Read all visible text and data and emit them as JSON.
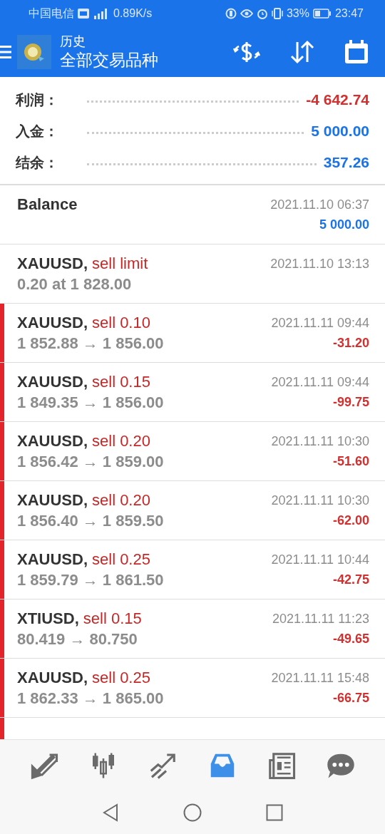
{
  "status_bar": {
    "carrier": "中国电信",
    "speed": "0.89K/s",
    "battery": "33%",
    "time": "23:47"
  },
  "header": {
    "title": "历史",
    "subtitle": "全部交易品种"
  },
  "summary": [
    {
      "label": "利润：",
      "value": "-4 642.74",
      "negative": true
    },
    {
      "label": "入金：",
      "value": "5 000.00",
      "negative": false
    },
    {
      "label": "结余：",
      "value": "357.26",
      "negative": false
    }
  ],
  "rows": [
    {
      "kind": "balance",
      "symbol": "Balance",
      "time": "2021.11.10 06:37",
      "profit": "5 000.00",
      "negative": false
    },
    {
      "kind": "order",
      "symbol": "XAUUSD,",
      "action": "sell limit",
      "color": "#c62828",
      "detail": "0.20 at 1 828.00",
      "time": "2021.11.10 13:13"
    },
    {
      "kind": "deal",
      "symbol": "XAUUSD,",
      "action": "sell 0.10",
      "color": "#c62828",
      "detail": "1 852.88 → 1 856.00",
      "time": "2021.11.11 09:44",
      "profit": "-31.20",
      "negative": true
    },
    {
      "kind": "deal",
      "symbol": "XAUUSD,",
      "action": "sell 0.15",
      "color": "#c62828",
      "detail": "1 849.35 → 1 856.00",
      "time": "2021.11.11 09:44",
      "profit": "-99.75",
      "negative": true
    },
    {
      "kind": "deal",
      "symbol": "XAUUSD,",
      "action": "sell 0.20",
      "color": "#c62828",
      "detail": "1 856.42 → 1 859.00",
      "time": "2021.11.11 10:30",
      "profit": "-51.60",
      "negative": true
    },
    {
      "kind": "deal",
      "symbol": "XAUUSD,",
      "action": "sell 0.20",
      "color": "#c62828",
      "detail": "1 856.40 → 1 859.50",
      "time": "2021.11.11 10:30",
      "profit": "-62.00",
      "negative": true
    },
    {
      "kind": "deal",
      "symbol": "XAUUSD,",
      "action": "sell 0.25",
      "color": "#c62828",
      "detail": "1 859.79 → 1 861.50",
      "time": "2021.11.11 10:44",
      "profit": "-42.75",
      "negative": true
    },
    {
      "kind": "deal",
      "symbol": "XTIUSD,",
      "action": "sell 0.15",
      "color": "#c62828",
      "detail": "80.419 → 80.750",
      "time": "2021.11.11 11:23",
      "profit": "-49.65",
      "negative": true
    },
    {
      "kind": "deal",
      "symbol": "XAUUSD,",
      "action": "sell 0.25",
      "color": "#c62828",
      "detail": "1 862.33 → 1 865.00",
      "time": "2021.11.11 15:48",
      "profit": "-66.75",
      "negative": true
    }
  ],
  "bottom_nav": [
    {
      "selected": false
    },
    {
      "selected": false
    },
    {
      "selected": false
    },
    {
      "selected": true
    },
    {
      "selected": false
    },
    {
      "selected": false
    }
  ]
}
